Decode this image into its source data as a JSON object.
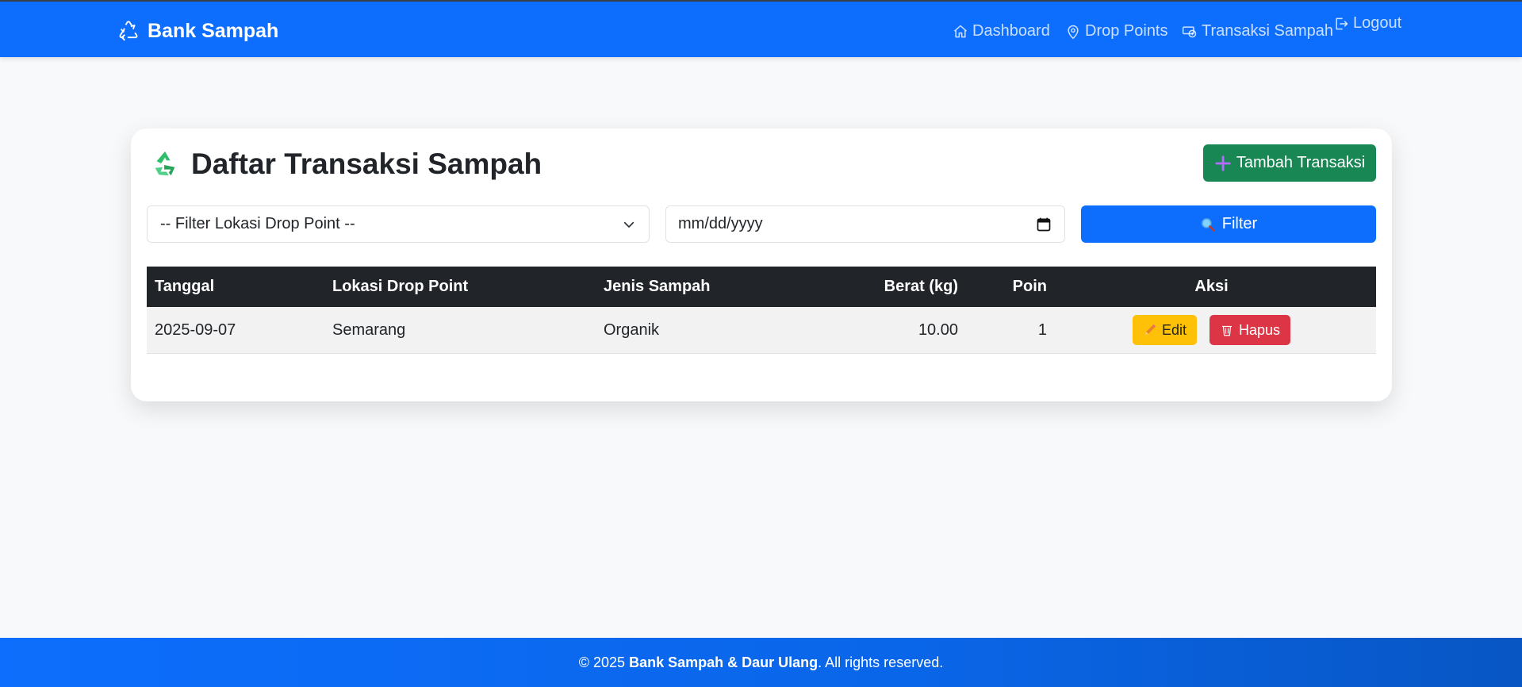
{
  "navbar": {
    "brand": "Bank Sampah",
    "links": {
      "dashboard": "Dashboard",
      "drop_points": "Drop Points",
      "transaksi": "Transaksi Sampah",
      "logout": "Logout"
    }
  },
  "card": {
    "title": "Daftar Transaksi Sampah",
    "add_button": "Tambah Transaksi",
    "filter_select": "-- Filter Lokasi Drop Point --",
    "date_placeholder": "mm/dd/yyyy",
    "filter_button": "Filter"
  },
  "table": {
    "headers": {
      "tanggal": "Tanggal",
      "lokasi": "Lokasi Drop Point",
      "jenis": "Jenis Sampah",
      "berat": "Berat (kg)",
      "poin": "Poin",
      "aksi": "Aksi"
    },
    "rows": [
      {
        "tanggal": "2025-09-07",
        "lokasi": "Semarang",
        "jenis": "Organik",
        "berat": "10.00",
        "poin": "1",
        "edit_label": "Edit",
        "hapus_label": "Hapus"
      }
    ]
  },
  "footer": {
    "prefix": "© 2025 ",
    "org": "Bank Sampah & Daur Ulang",
    "suffix": ". All rights reserved."
  },
  "colors": {
    "primary": "#0d6efd",
    "success": "#198754",
    "warning": "#ffc107",
    "danger": "#dc3545",
    "dark": "#212529"
  }
}
